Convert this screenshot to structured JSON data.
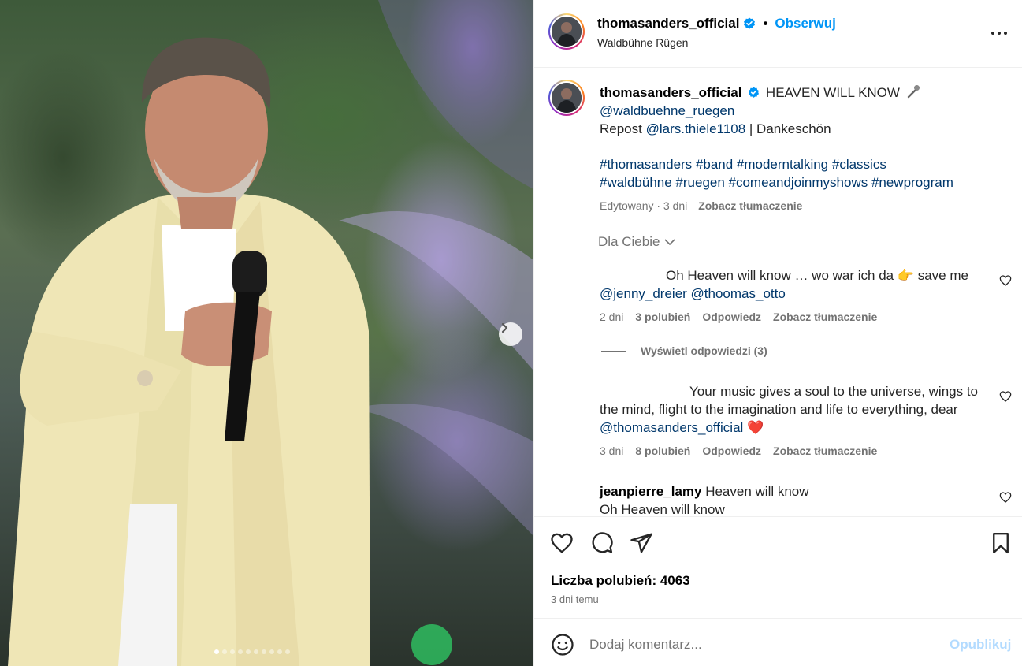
{
  "post": {
    "username": "thomasanders_official",
    "follow_label": "Obserwuj",
    "location": "Waldbühne Rügen",
    "media_pages": 10,
    "media_active_index": 0
  },
  "caption": {
    "username": "thomasanders_official",
    "title": "HEAVEN WILL KNOW",
    "mention_venue": "@waldbuehne_ruegen",
    "repost_prefix": "Repost",
    "repost_mention": "@lars.thiele1108",
    "repost_suffix": "| Dankeschön",
    "hashtags_line1": "#thomasanders #band #moderntalking #classics",
    "hashtags_line2": "#waldbühne #ruegen #comeandjoinmyshows #newprogram",
    "edited": "Edytowany · 3 dni",
    "translate": "Zobacz tłumaczenie"
  },
  "filter_label": "Dla Ciebie",
  "comments": [
    {
      "text": "Oh Heaven will know … wo war ich da 👉 save me",
      "mentions": "@jenny_dreier @thoomas_otto",
      "time": "2 dni",
      "likes": "3 polubień",
      "reply": "Odpowiedz",
      "translate": "Zobacz tłumaczenie",
      "view_replies": "Wyświetl odpowiedzi (3)"
    },
    {
      "text_line1": "Your music gives a soul to the universe, wings to",
      "text_line2": "the mind, flight to the imagination and life to everything, dear",
      "mention": "@thomasanders_official",
      "emoji": "❤️",
      "time": "3 dni",
      "likes": "8 polubień",
      "reply": "Odpowiedz",
      "translate": "Zobacz tłumaczenie"
    },
    {
      "username": "jeanpierre_lamy",
      "text_line1": "Heaven will know",
      "text_line2": "Oh Heaven will know"
    }
  ],
  "likes_label": "Liczba polubień: 4063",
  "posted_when": "3 dni temu",
  "add_comment": {
    "placeholder": "Dodaj komentarz...",
    "publish_label": "Opublikuj"
  },
  "colors": {
    "accent": "#0095f6",
    "link": "#00376b",
    "muted": "#737373",
    "publish_disabled": "#b3dbff"
  }
}
